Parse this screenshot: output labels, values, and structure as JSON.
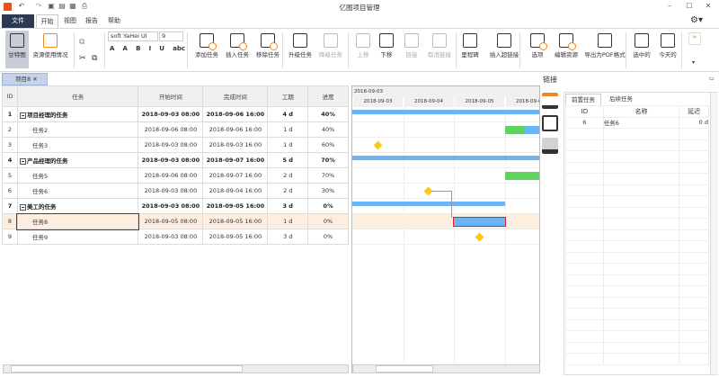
{
  "window": {
    "title": "亿图项目管理"
  },
  "menu": {
    "file": "文件",
    "tabs": [
      "开始",
      "视图",
      "报告",
      "帮助"
    ]
  },
  "ribbon": {
    "view_buttons": [
      "甘特图",
      "资源使用情况"
    ],
    "font_name": "soft YaHei UI",
    "font_size": "9",
    "format_glyphs": [
      "A",
      "A",
      "B",
      "I",
      "U",
      "abc"
    ],
    "task_buttons": [
      "添加任务",
      "插入任务",
      "移除任务",
      "升级任务",
      "降级任务",
      "上移",
      "下移",
      "链接",
      "取消链接",
      "里程碑",
      "插入超链接",
      "选项",
      "编辑资源",
      "导出为PDF格式",
      "选中的",
      "今天的"
    ]
  },
  "doc_tab": {
    "label": "项目8"
  },
  "grid": {
    "columns": [
      "ID",
      "任务",
      "开始时间",
      "完成时间",
      "工期",
      "进度"
    ],
    "rows": [
      {
        "id": "1",
        "name": "项目经理的任务",
        "start": "2018-09-03 08:00",
        "end": "2018-09-06 16:00",
        "dur": "4 d",
        "progress": "40%",
        "summary": true,
        "s": 0,
        "d": 4,
        "p": 0.4
      },
      {
        "id": "2",
        "name": "任务2",
        "start": "2018-09-06 08:00",
        "end": "2018-09-06 16:00",
        "dur": "1 d",
        "progress": "40%",
        "s": 3,
        "d": 1,
        "p": 0.4
      },
      {
        "id": "3",
        "name": "任务3",
        "start": "2018-09-03 08:00",
        "end": "2018-09-03 16:00",
        "dur": "1 d",
        "progress": "60%",
        "milestone": true,
        "s": 0.5
      },
      {
        "id": "4",
        "name": "产品经理的任务",
        "start": "2018-09-03 08:00",
        "end": "2018-09-07 16:00",
        "dur": "5 d",
        "progress": "70%",
        "summary": true,
        "s": 0,
        "d": 5,
        "p": 0.7
      },
      {
        "id": "5",
        "name": "任务5",
        "start": "2018-09-06 08:00",
        "end": "2018-09-07 16:00",
        "dur": "2 d",
        "progress": "70%",
        "s": 3,
        "d": 2,
        "p": 0.7
      },
      {
        "id": "6",
        "name": "任务6",
        "start": "2018-09-03 08:00",
        "end": "2018-09-04 16:00",
        "dur": "2 d",
        "progress": "30%",
        "milestone": true,
        "s": 1.5
      },
      {
        "id": "7",
        "name": "美工的任务",
        "start": "2018-09-03 08:00",
        "end": "2018-09-05 16:00",
        "dur": "3 d",
        "progress": "0%",
        "summary": true,
        "s": 0,
        "d": 3,
        "p": 0
      },
      {
        "id": "8",
        "name": "任务8",
        "start": "2018-09-05 08:00",
        "end": "2018-09-05 16:00",
        "dur": "1 d",
        "progress": "0%",
        "selected": true,
        "s": 2,
        "d": 1,
        "p": 0
      },
      {
        "id": "9",
        "name": "任务9",
        "start": "2018-09-03 08:00",
        "end": "2018-09-05 16:00",
        "dur": "3 d",
        "progress": "0%",
        "milestone": true,
        "s": 2.5
      }
    ]
  },
  "gantt": {
    "top_label": "2018-09-03",
    "days": [
      "2018-09-03",
      "2018-09-04",
      "2018-09-05",
      "2018-09-06"
    ]
  },
  "panel": {
    "title": "链接",
    "tabs": [
      "前置任务",
      "后续任务"
    ],
    "columns": [
      "ID",
      "名称",
      "延迟"
    ],
    "rows": [
      {
        "id": "6",
        "name": "任务6",
        "lag": "0 d"
      }
    ]
  },
  "colors": {
    "progress": "#5fd35f",
    "bar": "#6cb4f8",
    "milestone": "#f9c818",
    "selected": "#fdeee0",
    "accent": "#f08a1c"
  }
}
